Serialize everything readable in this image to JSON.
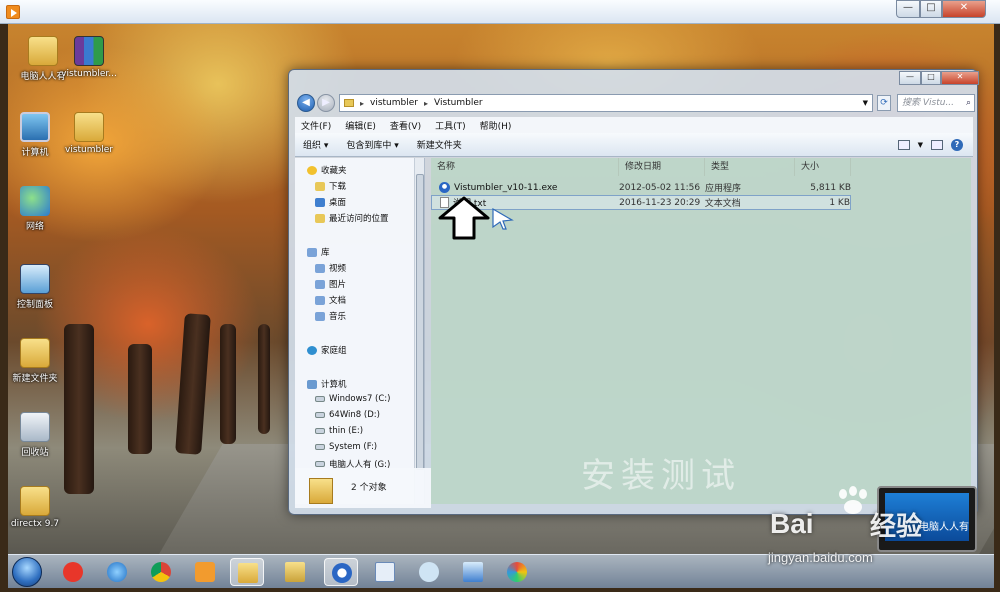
{
  "outer_window": {
    "controls": {
      "minimize": "—",
      "maximize": "□",
      "close": "✕"
    }
  },
  "desktop_icons": [
    {
      "label": "电脑人人有",
      "icon": "user-folder-icon"
    },
    {
      "label": "vistumbler...",
      "icon": "winrar-icon"
    },
    {
      "label": "计算机",
      "icon": "computer-icon"
    },
    {
      "label": "vistumbler",
      "icon": "folder-icon"
    },
    {
      "label": "网络",
      "icon": "network-icon"
    },
    {
      "label": "控制面板",
      "icon": "control-panel-icon"
    },
    {
      "label": "新建文件夹",
      "icon": "folder-icon"
    },
    {
      "label": "回收站",
      "icon": "recycle-bin-icon"
    },
    {
      "label": "directx 9.7",
      "icon": "folder-icon"
    }
  ],
  "explorer": {
    "title_controls": {
      "minimize": "—",
      "maximize": "□",
      "close": "✕"
    },
    "breadcrumb": [
      "vistumbler",
      "Vistumbler"
    ],
    "search_placeholder": "搜索 Vistu...",
    "menu": [
      "文件(F)",
      "编辑(E)",
      "查看(V)",
      "工具(T)",
      "帮助(H)"
    ],
    "toolbar": {
      "organize": "组织 ▾",
      "include_library": "包含到库中 ▾",
      "new_folder": "新建文件夹"
    },
    "nav": {
      "favorites": "收藏夹",
      "downloads": "下载",
      "desktop": "桌面",
      "recent": "最近访问的位置",
      "library": "库",
      "videos": "视频",
      "pictures": "图片",
      "documents": "文档",
      "music": "音乐",
      "homegroup": "家庭组",
      "computer": "计算机",
      "drives": [
        "Windows7 (C:)",
        "64Win8 (D:)",
        "thin (E:)",
        "System (F:)",
        "电脑人人有 (G:)"
      ]
    },
    "columns": [
      "名称",
      "修改日期",
      "类型",
      "大小"
    ],
    "files": [
      {
        "name": "Vistumbler_v10-11.exe",
        "date": "2012-05-02 11:56",
        "type": "应用程序",
        "size": "5,811 KB",
        "icon": "exe-icon"
      },
      {
        "name": "说明.txt",
        "date": "2016-11-23 20:29",
        "type": "文本文档",
        "size": "1 KB",
        "icon": "text-file-icon"
      }
    ],
    "status_count": "2 个对象",
    "overlay_text": "安装测试"
  },
  "taskbar": {
    "items": [
      "start",
      "360-icon",
      "ie-icon",
      "chrome-icon",
      "media-player-icon",
      "explorer-icon",
      "folder-icon",
      "vistumbler-icon",
      "document-icon",
      "flower-icon",
      "control-panel-icon",
      "paint-icon"
    ]
  },
  "watermark": {
    "brand": "Bai",
    "brand2": "经验",
    "url": "jingyan.baidu.com",
    "laptop_caption": "电脑人人有"
  }
}
